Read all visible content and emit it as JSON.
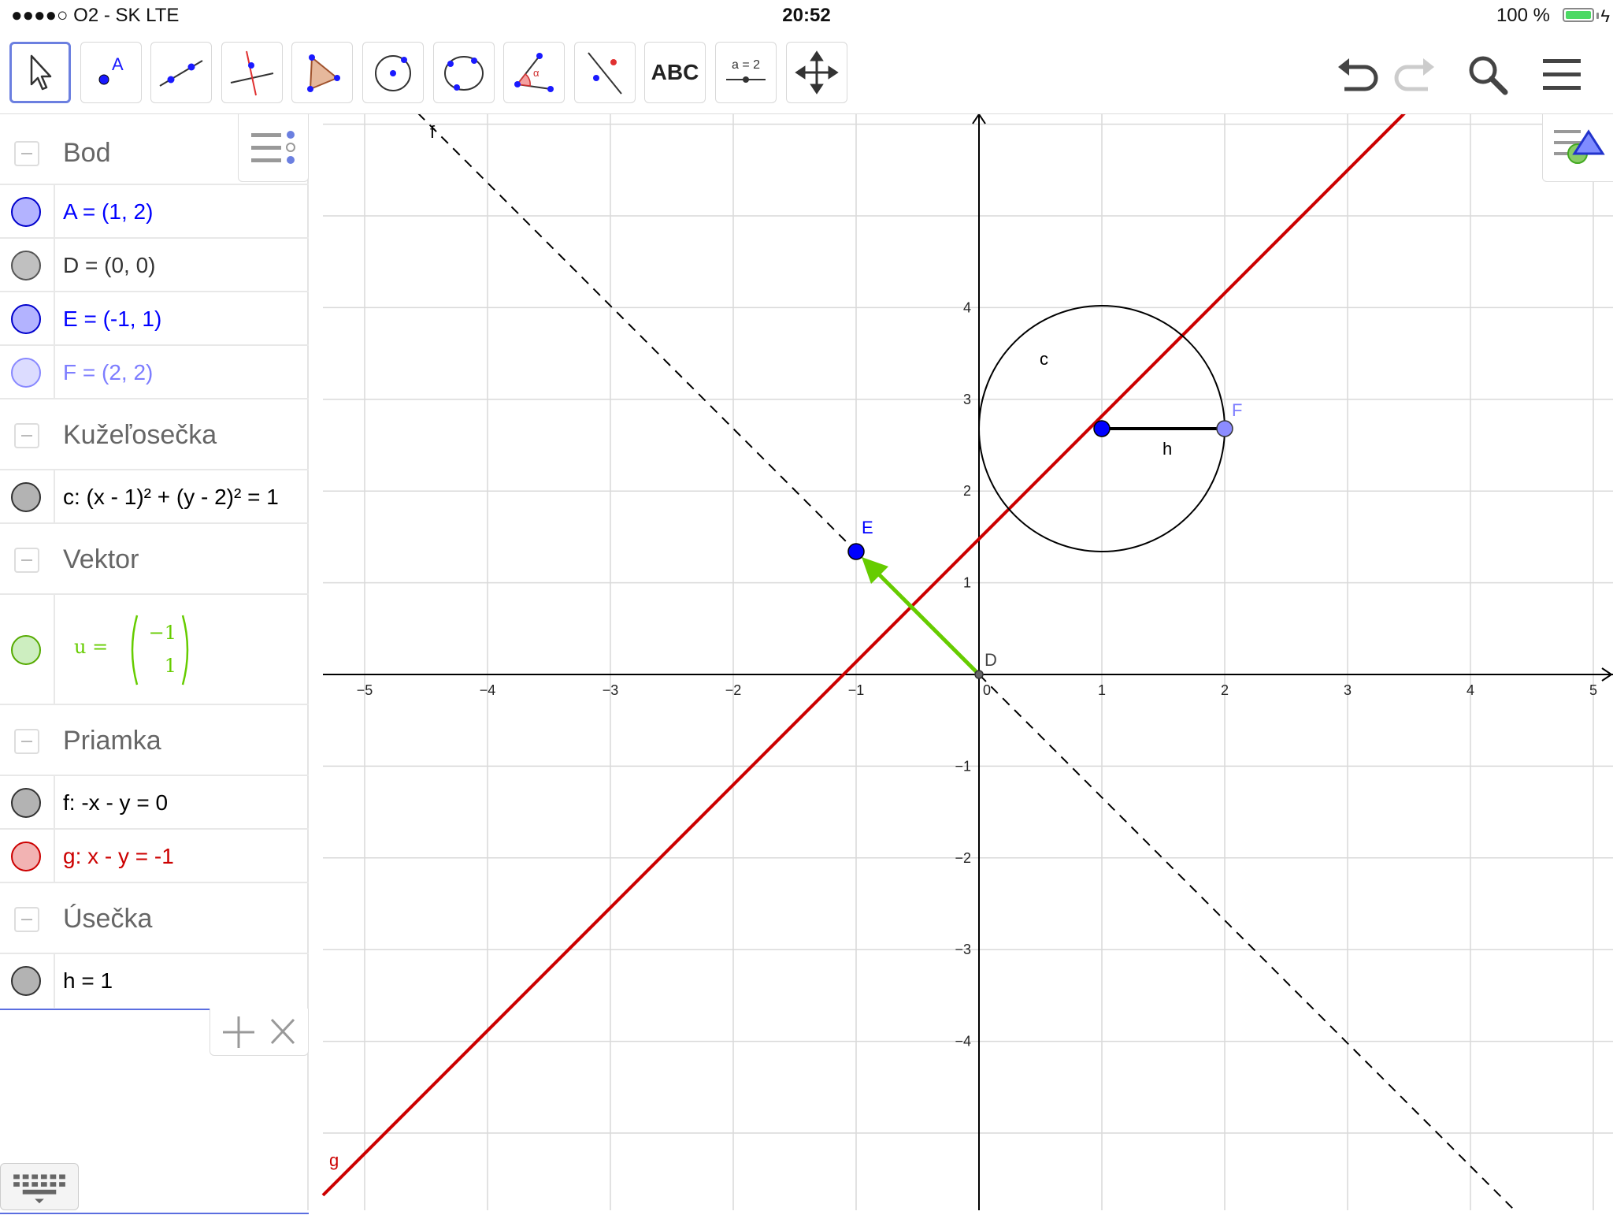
{
  "status_bar": {
    "carrier": "●●●●○ O2 - SK   LTE",
    "time": "20:52",
    "battery": "100 %"
  },
  "toolbar": {
    "tools": [
      {
        "icon": "move-arrow-icon",
        "selected": true
      },
      {
        "icon": "point-icon",
        "label": "A"
      },
      {
        "icon": "line-icon"
      },
      {
        "icon": "perpendicular-line-icon"
      },
      {
        "icon": "polygon-icon"
      },
      {
        "icon": "circle-center-point-icon"
      },
      {
        "icon": "circle-three-points-icon"
      },
      {
        "icon": "angle-icon",
        "label": "α"
      },
      {
        "icon": "reflect-about-line-icon"
      },
      {
        "icon": "text-icon",
        "label": "ABC"
      },
      {
        "icon": "slider-icon",
        "label": "a = 2"
      },
      {
        "icon": "move-graphics-view-icon"
      }
    ],
    "right": [
      "undo-icon",
      "redo-icon",
      "search-icon",
      "menu-icon"
    ]
  },
  "algebra": {
    "groups": [
      {
        "title": "Bod",
        "items": [
          {
            "text": "A = (1, 2)",
            "color": "#0000ff",
            "marble": "#b3b3ff"
          },
          {
            "text": "D = (0, 0)",
            "color": "#333333",
            "marble": "#c0c0c0"
          },
          {
            "text": "E = (-1, 1)",
            "color": "#0000ff",
            "marble": "#b3b3ff"
          },
          {
            "text": "F = (2, 2)",
            "color": "#7d7dff",
            "marble": "#dcdcff"
          }
        ]
      },
      {
        "title": "Kužeľosečka",
        "items": [
          {
            "text": "c: (x - 1)² + (y - 2)² = 1",
            "color": "#000000",
            "marble": "#b3b3b3"
          }
        ]
      },
      {
        "title": "Vektor",
        "items": [
          {
            "text": "u =",
            "vector": [
              "−1",
              "1"
            ],
            "color": "#66cc00",
            "marble": "#cdeec0"
          }
        ]
      },
      {
        "title": "Priamka",
        "items": [
          {
            "text": "f: -x - y = 0",
            "color": "#000000",
            "marble": "#b3b3b3"
          },
          {
            "text": "g: x - y = -1",
            "color": "#cc0000",
            "marble": "#f2b3b3"
          }
        ]
      },
      {
        "title": "Úsečka",
        "items": [
          {
            "text": "h = 1",
            "color": "#000000",
            "marble": "#b3b3b3"
          }
        ]
      }
    ]
  },
  "graphics": {
    "x_ticks": [
      "−5",
      "−4",
      "−3",
      "−2",
      "−1",
      "0",
      "1",
      "2",
      "3",
      "4",
      "5"
    ],
    "y_ticks": [
      "4",
      "3",
      "2",
      "1",
      "−1",
      "−2",
      "−3",
      "−4"
    ],
    "labels": {
      "f": "f",
      "g": "g",
      "c": "c",
      "h": "h",
      "E": "E",
      "F": "F",
      "D": "D"
    },
    "colors": {
      "g": "#cc0000",
      "u": "#66cc00",
      "point": "#0000ff",
      "F": "#7d7dff"
    }
  }
}
